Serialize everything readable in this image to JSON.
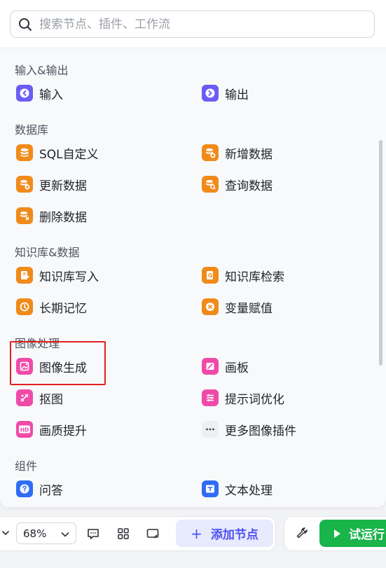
{
  "search": {
    "placeholder": "搜索节点、插件、工作流"
  },
  "sections": {
    "io": {
      "title": "输入&输出",
      "input": "输入",
      "output": "输出"
    },
    "db": {
      "title": "数据库",
      "sql": "SQL自定义",
      "insert": "新增数据",
      "update": "更新数据",
      "query": "查询数据",
      "delete": "删除数据"
    },
    "kb": {
      "title": "知识库&数据",
      "write": "知识库写入",
      "search": "知识库检索",
      "memory": "长期记忆",
      "variable": "变量赋值"
    },
    "image": {
      "title": "图像处理",
      "generate": "图像生成",
      "canvas": "画板",
      "cutout": "抠图",
      "prompt_opt": "提示词优化",
      "upscale": "画质提升",
      "more": "更多图像插件"
    },
    "components": {
      "title": "组件",
      "qa": "问答",
      "text": "文本处理"
    }
  },
  "toolbar": {
    "zoom": "68%",
    "add_node": "添加节点",
    "run": "试运行"
  },
  "colors": {
    "accent": "#4c52f2",
    "run_green": "#19b44a",
    "highlight_red": "#e0211c"
  }
}
